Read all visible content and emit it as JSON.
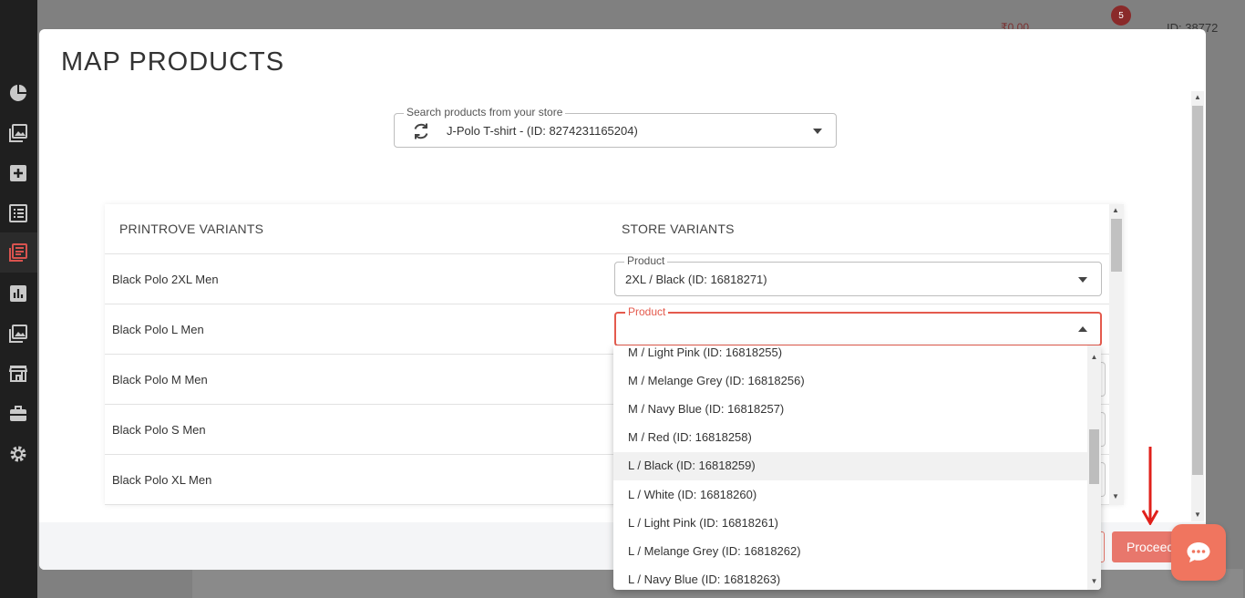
{
  "background": {
    "wallet": "₹0.00",
    "notification_count": "5",
    "user_id": "ID: 38772"
  },
  "sidebar": {
    "icons": [
      "dashboard-icon",
      "gallery-icon",
      "add-icon",
      "list-icon",
      "orders-icon",
      "analytics-icon",
      "images-icon",
      "store-icon",
      "briefcase-icon",
      "settings-icon"
    ],
    "active": "orders-icon"
  },
  "modal": {
    "title": "MAP PRODUCTS",
    "search": {
      "label": "Search products from your store",
      "value": "J-Polo T-shirt - (ID: 8274231165204)"
    },
    "table": {
      "col_printrove": "PRINTROVE VARIANTS",
      "col_store": "STORE VARIANTS",
      "rows": [
        {
          "variant": "Black Polo 2XL Men",
          "select_label": "Product",
          "select_value": "2XL / Black (ID: 16818271)"
        },
        {
          "variant": "Black Polo L Men",
          "select_label": "Product",
          "select_value": ""
        },
        {
          "variant": "Black Polo M Men"
        },
        {
          "variant": "Black Polo S Men"
        },
        {
          "variant": "Black Polo XL Men"
        }
      ]
    },
    "footer": {
      "proceed_label": "Proceed"
    }
  },
  "dropdown": {
    "options": [
      "M / Light Pink (ID: 16818255)",
      "M / Melange Grey (ID: 16818256)",
      "M / Navy Blue (ID: 16818257)",
      "M / Red (ID: 16818258)",
      "L / Black (ID: 16818259)",
      "L / White (ID: 16818260)",
      "L / Light Pink (ID: 16818261)",
      "L / Melange Grey (ID: 16818262)",
      "L / Navy Blue (ID: 16818263)"
    ],
    "highlighted": "L / Black (ID: 16818259)"
  },
  "colors": {
    "accent": "#e8776c",
    "focus": "#e45a4d",
    "annotation_arrow": "#e0201b"
  }
}
